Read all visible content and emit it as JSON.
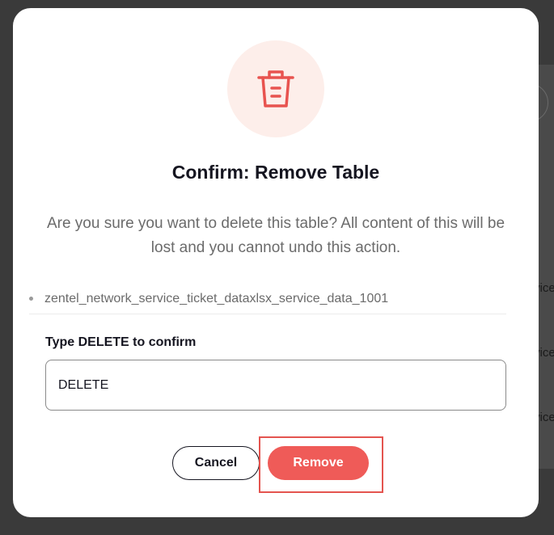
{
  "dialog": {
    "title": "Confirm: Remove Table",
    "message": "Are you sure you want to delete this table? All content of this will be lost and you cannot undo this action.",
    "items": [
      "zentel_network_service_ticket_dataxlsx_service_data_1001"
    ],
    "confirm_label": "Type DELETE to confirm",
    "confirm_value": "DELETE",
    "icon": "trash-icon",
    "cancel_label": "Cancel",
    "remove_label": "Remove"
  },
  "background": {
    "side_text": [
      "vice",
      "vice",
      "vice"
    ]
  },
  "colors": {
    "accent": "#ef5b58",
    "icon_bg": "#fdeeea",
    "overlay": "#3a3a3a"
  }
}
